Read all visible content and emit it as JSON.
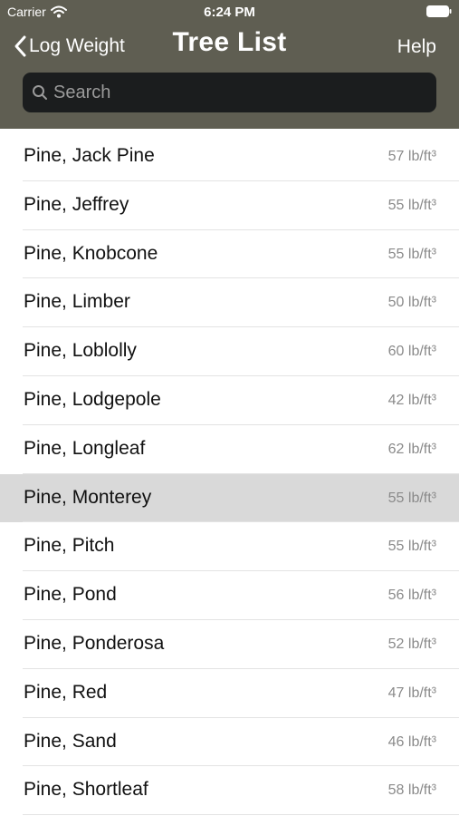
{
  "status_bar": {
    "carrier": "Carrier",
    "time": "6:24 PM"
  },
  "nav": {
    "back_label": "Log Weight",
    "title": "Tree List",
    "help_label": "Help"
  },
  "search": {
    "placeholder": "Search",
    "value": ""
  },
  "colors": {
    "header_bg": "#5f5e52",
    "search_bg": "#1b1d1e",
    "selected_row_bg": "#d9d9d9"
  },
  "trees": [
    {
      "name": "Pine, Jack Pine",
      "density": "57 lb/ft³"
    },
    {
      "name": "Pine, Jeffrey",
      "density": "55 lb/ft³"
    },
    {
      "name": "Pine, Knobcone",
      "density": "55 lb/ft³"
    },
    {
      "name": "Pine, Limber",
      "density": "50 lb/ft³"
    },
    {
      "name": "Pine, Loblolly",
      "density": "60 lb/ft³"
    },
    {
      "name": "Pine, Lodgepole",
      "density": "42 lb/ft³"
    },
    {
      "name": "Pine, Longleaf",
      "density": "62 lb/ft³"
    },
    {
      "name": "Pine, Monterey",
      "density": "55 lb/ft³",
      "selected": true
    },
    {
      "name": "Pine, Pitch",
      "density": "55 lb/ft³"
    },
    {
      "name": "Pine, Pond",
      "density": "56 lb/ft³"
    },
    {
      "name": "Pine, Ponderosa",
      "density": "52 lb/ft³"
    },
    {
      "name": "Pine, Red",
      "density": "47 lb/ft³"
    },
    {
      "name": "Pine, Sand",
      "density": "46 lb/ft³"
    },
    {
      "name": "Pine, Shortleaf",
      "density": "58 lb/ft³"
    }
  ]
}
